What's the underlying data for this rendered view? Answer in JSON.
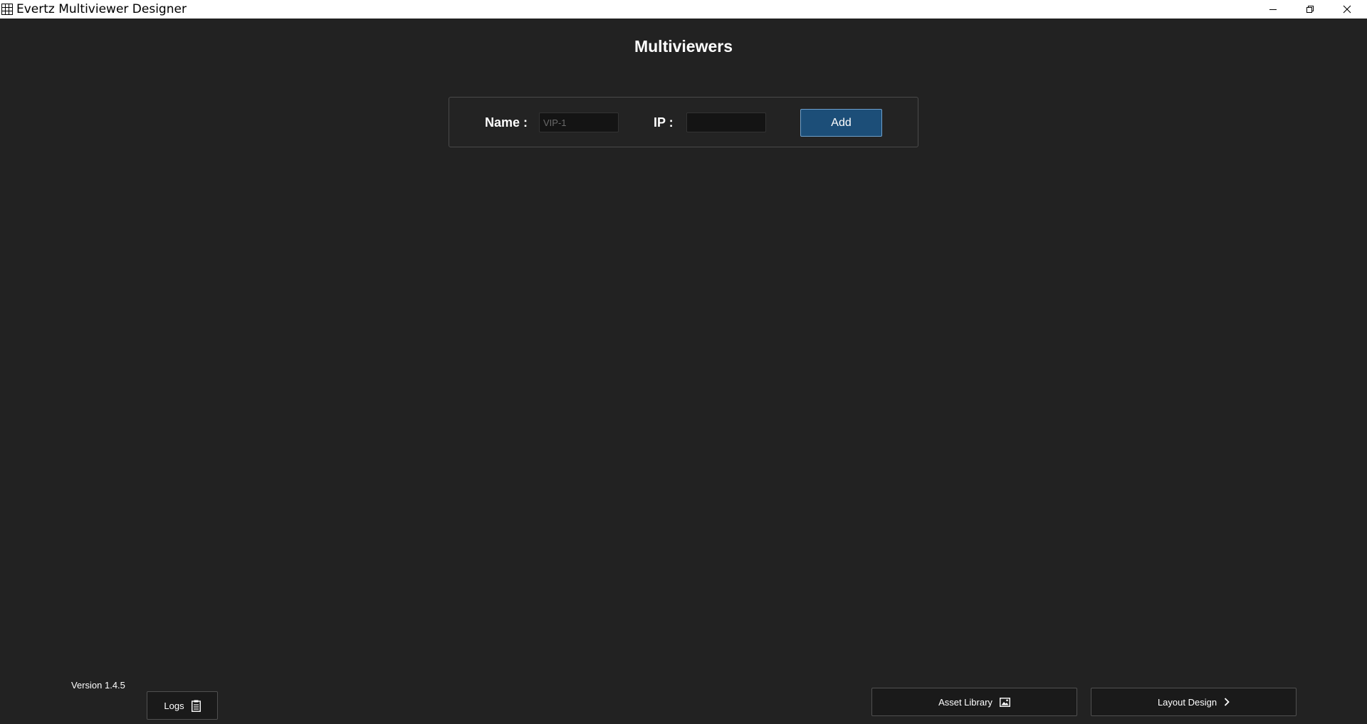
{
  "window": {
    "title": "Evertz Multiviewer Designer",
    "icon": "grid-app-icon",
    "controls": [
      "minimize-icon",
      "restore-icon",
      "close-icon"
    ]
  },
  "page": {
    "title": "Multiviewers"
  },
  "form": {
    "name_label": "Name :",
    "name_placeholder": "VIP-1",
    "name_value": "",
    "ip_label": "IP :",
    "ip_placeholder": "",
    "ip_value": "",
    "add_label": "Add"
  },
  "footer": {
    "version": "Version 1.4.5",
    "logs_label": "Logs",
    "logs_icon": "clipboard-icon",
    "asset_library_label": "Asset Library",
    "asset_library_icon": "image-icon",
    "layout_design_label": "Layout Design",
    "layout_design_icon": "chevron-right-icon"
  },
  "colors": {
    "background": "#222222",
    "accent_button": "#1c4e78",
    "accent_border": "#6f9fc9",
    "text": "#ffffff"
  }
}
